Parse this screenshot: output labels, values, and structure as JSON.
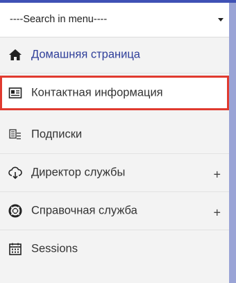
{
  "search": {
    "text": "----Search in menu----"
  },
  "menu": {
    "items": [
      {
        "label": "Домашняя страница",
        "icon": "home-icon",
        "expandable": false
      },
      {
        "label": "Контактная информация",
        "icon": "contact-card-icon",
        "expandable": false,
        "selected": true
      },
      {
        "label": "Подписки",
        "icon": "subscriptions-icon",
        "expandable": false
      },
      {
        "label": "Директор службы",
        "icon": "cloud-director-icon",
        "expandable": true,
        "toggle": "+"
      },
      {
        "label": "Справочная служба",
        "icon": "lifebuoy-icon",
        "expandable": true,
        "toggle": "+"
      },
      {
        "label": "Sessions",
        "icon": "calendar-icon",
        "expandable": false
      }
    ]
  },
  "colors": {
    "accent": "#3f51b5",
    "home_label": "#2f3f9a",
    "selection_border": "#e03a2f",
    "menu_bg": "#f3f3f3"
  }
}
